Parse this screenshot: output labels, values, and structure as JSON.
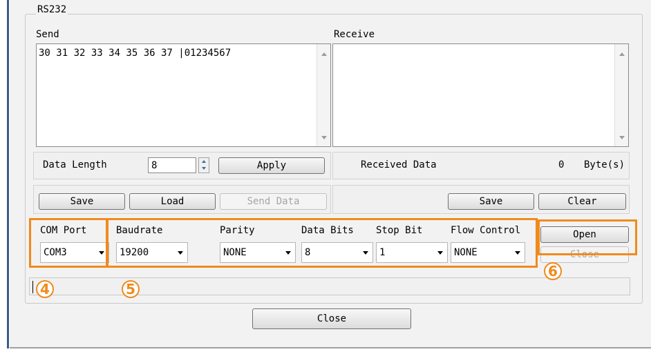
{
  "group_title": "RS232",
  "send": {
    "label": "Send",
    "text": "30 31 32 33 34 35 36 37 |01234567",
    "data_length_label": "Data Length",
    "data_length_value": "8",
    "apply_label": "Apply",
    "save_label": "Save",
    "load_label": "Load",
    "send_data_label": "Send Data"
  },
  "receive": {
    "label": "Receive",
    "text": "",
    "received_data_label": "Received Data",
    "received_count": "0",
    "unit": "Byte(s)",
    "save_label": "Save",
    "clear_label": "Clear"
  },
  "settings": {
    "com_port": {
      "label": "COM Port",
      "value": "COM3"
    },
    "baudrate": {
      "label": "Baudrate",
      "value": "19200"
    },
    "parity": {
      "label": "Parity",
      "value": "NONE"
    },
    "data_bits": {
      "label": "Data Bits",
      "value": "8"
    },
    "stop_bit": {
      "label": "Stop Bit",
      "value": "1"
    },
    "flow_control": {
      "label": "Flow Control",
      "value": "NONE"
    }
  },
  "open_label": "Open",
  "close_port_label": "Close",
  "close_label": "Close",
  "annotations": {
    "a4": "4",
    "a5": "5",
    "a6": "6"
  },
  "colors": {
    "annotation": "#f08a1c",
    "window_bg": "#f2f2f2",
    "frame": "#3a5a8a"
  }
}
